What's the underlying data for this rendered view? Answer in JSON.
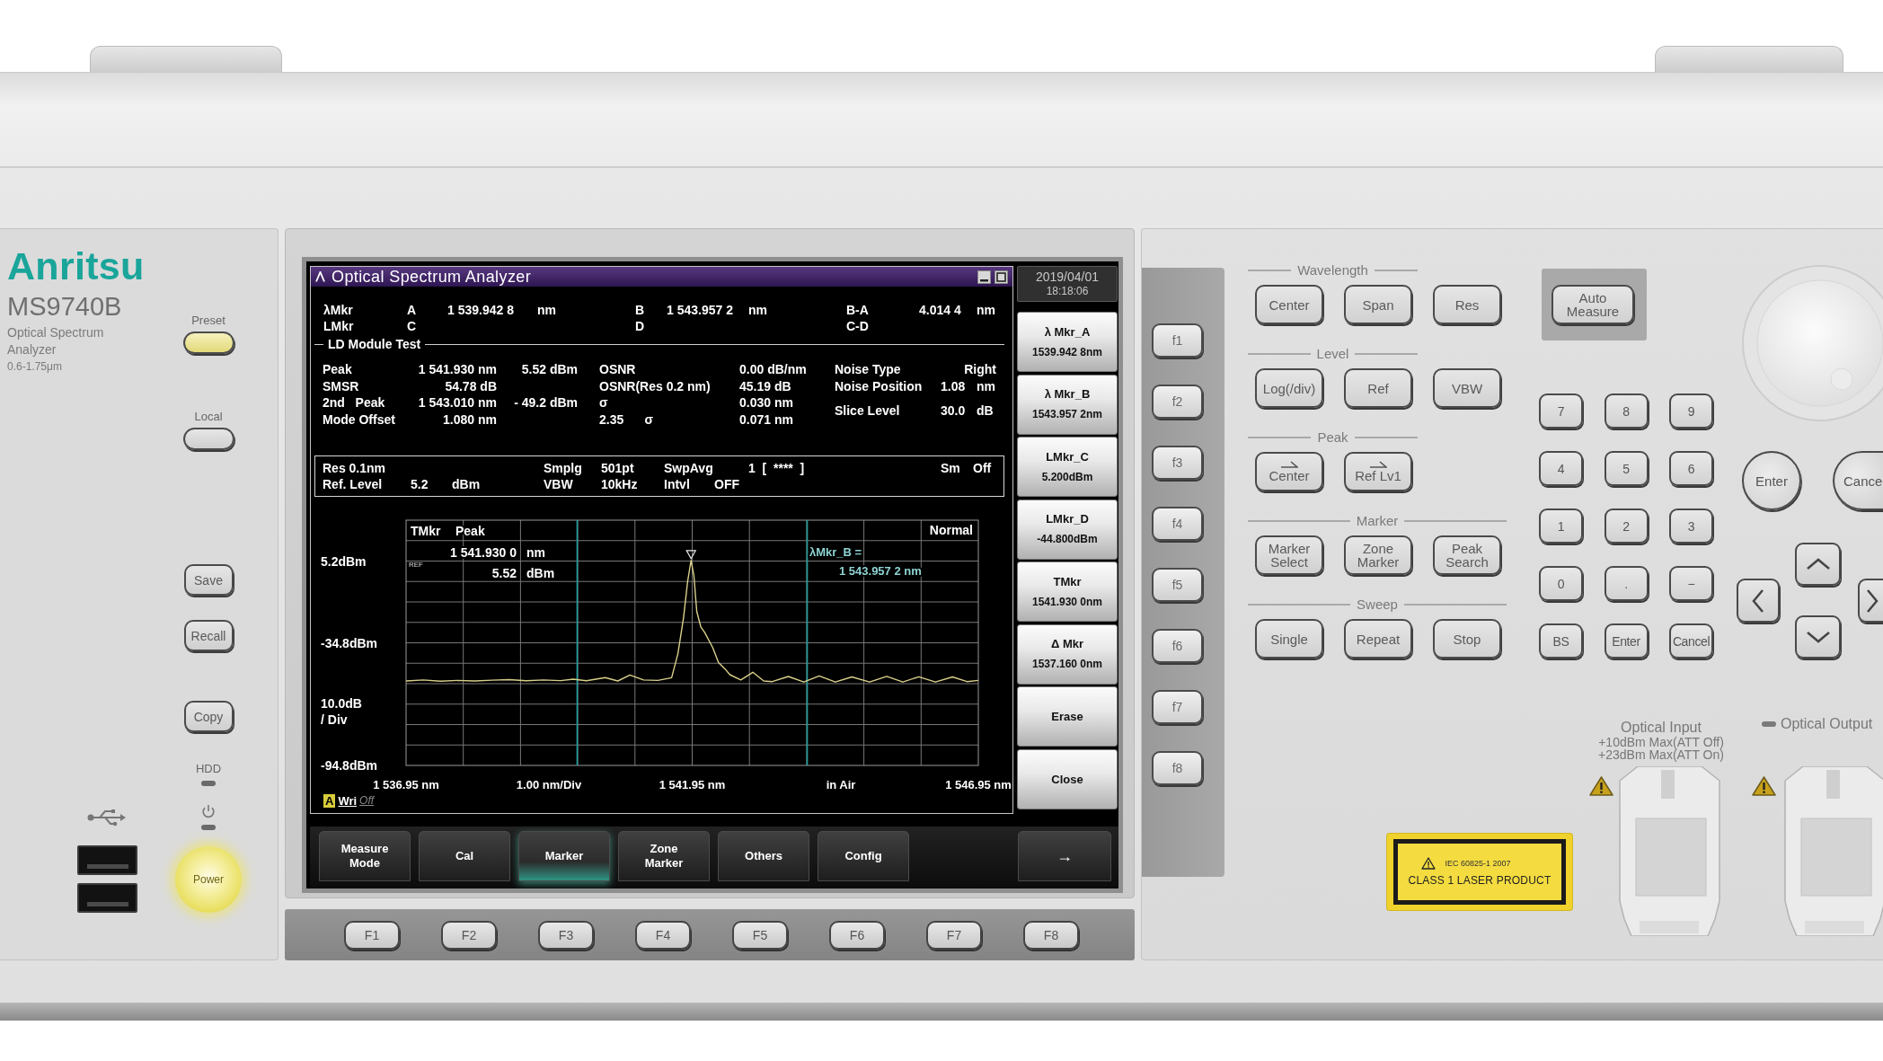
{
  "brand": {
    "logo": "Anritsu",
    "model": "MS9740B",
    "description": [
      "Optical Spectrum",
      "Analyzer"
    ],
    "range": "0.6-1.75μm"
  },
  "left_panel": {
    "keys": [
      {
        "kind": "captioned",
        "label": "Preset",
        "lit": true
      },
      {
        "kind": "captioned",
        "label": "Local",
        "lit": false
      },
      {
        "kind": "labeled",
        "label": "Save",
        "lit": false
      },
      {
        "kind": "labeled",
        "label": "Recall",
        "lit": false
      },
      {
        "kind": "labeled",
        "label": "Copy",
        "lit": false
      }
    ],
    "hdd_label": "HDD",
    "power": {
      "label": "Power",
      "lit": true
    }
  },
  "screen": {
    "window": {
      "title": "Optical Spectrum Analyzer"
    },
    "markers": [
      {
        "label": "λMkr",
        "pairs": [
          {
            "name": "A",
            "value": "1 539.942 8",
            "unit": "nm"
          },
          {
            "name": "B",
            "value": "1 543.957 2",
            "unit": "nm"
          },
          {
            "name": "B-A",
            "value": "4.014 4",
            "unit": "nm"
          }
        ]
      },
      {
        "label": "LMkr",
        "pairs": [
          {
            "name": "C"
          },
          {
            "name": "D"
          },
          {
            "name": "C-D"
          }
        ]
      }
    ],
    "ld_module_test": {
      "title": "LD Module Test",
      "results": [
        {
          "label": "Peak",
          "value": "1 541.930 nm",
          "power_value": "5.52 dBm",
          "metric": "OSNR",
          "metric_value": "0.00 dB/nm"
        },
        {
          "label": "SMSR",
          "value": "54.78 dB",
          "metric": "OSNR(Res 0.2 nm)",
          "metric_value": "45.19 dB"
        },
        {
          "label": "2nd   Peak",
          "value": "1 543.010 nm",
          "power_value": "- 49.2 dBm",
          "metric": "σ",
          "metric_value": "0.030 nm"
        },
        {
          "label": "Mode Offset",
          "value": "1.080 nm",
          "metric": "2.35      σ",
          "metric_value": "0.071 nm"
        }
      ],
      "settings": [
        {
          "label": "Noise Type",
          "value": "Right"
        },
        {
          "label": "Noise Position",
          "value": "1.08",
          "unit": "nm"
        },
        {
          "label": "Slice Level",
          "value": "30.0",
          "unit": "dB"
        }
      ]
    },
    "conditions": [
      [
        "Res 0.1nm",
        "Smplg",
        "501pt",
        "SwpAvg",
        "1  [  ****  ]",
        "Sm",
        "Off"
      ],
      [
        "Ref. Level",
        "5.2",
        "dBm",
        "VBW",
        "10kHz",
        "Intvl",
        "OFF"
      ]
    ],
    "graph": {
      "readout": {
        "label": "TMkr",
        "mode": "Peak",
        "wavelength": "1 541.930 0",
        "wavelength_unit": "nm",
        "ref": "REF",
        "power": "5.52",
        "power_unit": "dBm"
      },
      "trace_mode": "Normal",
      "delta_marker": {
        "label": "λMkr_B =",
        "value": "1 543.957 2 nm"
      },
      "scale": [
        "10.0dB",
        "/ Div"
      ],
      "x_scale": "1.00 nm/Div",
      "medium": "in Air",
      "chart_data": {
        "type": "line",
        "x": [
          1536.95,
          1537.25,
          1537.55,
          1537.85,
          1538.15,
          1538.45,
          1538.75,
          1539.05,
          1539.35,
          1539.65,
          1539.87,
          1540.1,
          1540.43,
          1540.65,
          1540.86,
          1541.1,
          1541.35,
          1541.59,
          1541.7,
          1541.8,
          1541.87,
          1541.93,
          1541.98,
          1542.03,
          1542.1,
          1542.17,
          1542.31,
          1542.41,
          1542.52,
          1542.61,
          1542.8,
          1543.01,
          1543.2,
          1543.35,
          1543.63,
          1543.9,
          1544.17,
          1544.45,
          1544.74,
          1545.05,
          1545.35,
          1545.63,
          1545.91,
          1546.2,
          1546.5,
          1546.75,
          1546.95
        ],
        "series": [
          {
            "name": "A",
            "color": "#d9d08a",
            "values": [
              -53.5,
              -53.0,
              -53.6,
              -53.2,
              -53.5,
              -53.1,
              -52.8,
              -53.4,
              -53.0,
              -53.3,
              -52.6,
              -53.4,
              -51.8,
              -53.5,
              -50.6,
              -53.0,
              -53.2,
              -51.9,
              -40.1,
              -22.4,
              -4.8,
              5.5,
              -1.9,
              -19.5,
              -27.0,
              -29.8,
              -37.2,
              -44.5,
              -47.5,
              -50.4,
              -53.0,
              -49.2,
              -53.5,
              -53.8,
              -51.3,
              -54.0,
              -51.0,
              -54.0,
              -51.5,
              -54.0,
              -51.2,
              -54.0,
              -51.4,
              -54.0,
              -51.5,
              -53.8,
              -53.2
            ]
          }
        ],
        "xlim": [
          1536.95,
          1546.95
        ],
        "ylim": [
          -94.8,
          25.2
        ],
        "xticks": [
          {
            "value": 1536.95,
            "label": "1 536.95 nm"
          },
          {
            "value": 1541.95,
            "label": "1 541.95 nm"
          },
          {
            "value": 1546.95,
            "label": "1 546.95 nm"
          }
        ],
        "yticks": [
          {
            "value": 5.2,
            "label": "5.2dBm"
          },
          {
            "value": -34.8,
            "label": "-34.8dBm"
          },
          {
            "value": -94.8,
            "label": "-94.8dBm"
          }
        ],
        "grid": true,
        "ref_lines": [
          {
            "axis": "x",
            "value": 1539.94
          },
          {
            "axis": "x",
            "value": 1543.96
          }
        ]
      }
    },
    "write_status": {
      "mode": "Wri",
      "state": "Off"
    },
    "date": "2019/04/01",
    "time": "18:18:06",
    "softkeys": [
      {
        "label": "λ Mkr_A",
        "value": "1539.942 8nm"
      },
      {
        "label": "λ Mkr_B",
        "value": "1543.957 2nm"
      },
      {
        "label": "LMkr_C",
        "value": "5.200dBm"
      },
      {
        "label": "LMkr_D",
        "value": "-44.800dBm"
      },
      {
        "label": "TMkr",
        "value": "1541.930 0nm"
      },
      {
        "label": "Δ Mkr",
        "value": "1537.160 0nm"
      },
      {
        "label": "Erase"
      },
      {
        "label": "Close"
      }
    ],
    "tabs": [
      {
        "label": "Measure Mode",
        "selected": false
      },
      {
        "label": "Cal",
        "selected": false
      },
      {
        "label": "Marker",
        "selected": true
      },
      {
        "label": "Zone Marker",
        "selected": false
      },
      {
        "label": "Others",
        "selected": false
      },
      {
        "label": "Config",
        "selected": false
      }
    ],
    "next_key": "→"
  },
  "function_keys": [
    "F1",
    "F2",
    "F3",
    "F4",
    "F5",
    "F6",
    "F7",
    "F8"
  ],
  "side_keys": [
    "f1",
    "f2",
    "f3",
    "f4",
    "f5",
    "f6",
    "f7",
    "f8"
  ],
  "control_groups": [
    {
      "title": "Wavelength",
      "buttons": [
        {
          "kind": "plain",
          "label": "Center"
        },
        {
          "kind": "plain",
          "label": "Span"
        },
        {
          "kind": "plain",
          "label": "Res"
        }
      ]
    },
    {
      "title": "Level",
      "buttons": [
        {
          "kind": "plain",
          "label": "Log(/div)"
        },
        {
          "kind": "plain",
          "label": "Ref"
        },
        {
          "kind": "plain",
          "label": "VBW"
        }
      ]
    },
    {
      "title": "Peak",
      "buttons": [
        {
          "kind": "arrow",
          "label": "Center"
        },
        {
          "kind": "arrow",
          "label": "Ref Lv1"
        }
      ]
    },
    {
      "title": "Marker",
      "buttons": [
        {
          "kind": "plain",
          "label": "Marker Select"
        },
        {
          "kind": "plain",
          "label": "Zone Marker"
        },
        {
          "kind": "plain",
          "label": "Peak Search"
        }
      ]
    },
    {
      "title": "Sweep",
      "buttons": [
        {
          "kind": "plain",
          "label": "Single"
        },
        {
          "kind": "plain",
          "label": "Repeat"
        },
        {
          "kind": "plain",
          "label": "Stop"
        }
      ]
    }
  ],
  "auto_measure": "Auto Measure",
  "numpad": [
    "7",
    "8",
    "9",
    "4",
    "5",
    "6",
    "1",
    "2",
    "3",
    "0",
    ".",
    "−",
    "BS",
    "Enter",
    "Cancel"
  ],
  "round_keys": [
    "Enter",
    "Cance"
  ],
  "optical_input": {
    "title": "Optical Input",
    "specs": [
      "+10dBm Max(ATT Off)",
      "+23dBm Max(ATT On)"
    ]
  },
  "optical_output": {
    "title": "Optical Output"
  },
  "laser_label": {
    "standard": "IEC 60825-1 2007",
    "text": "CLASS 1 LASER PRODUCT"
  }
}
